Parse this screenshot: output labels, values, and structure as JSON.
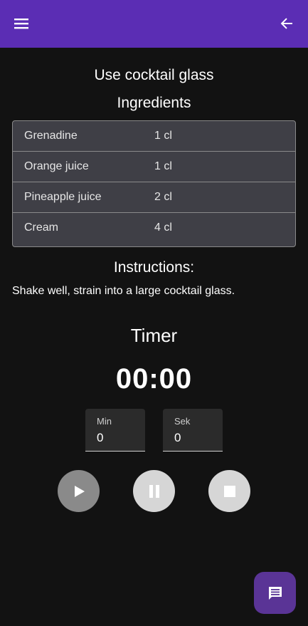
{
  "appbar": {
    "menu_icon": "menu-icon",
    "back_icon": "arrow-back-icon",
    "color": "#5b2db4"
  },
  "glass": "Use cocktail glass",
  "ingredients_title": "Ingredients",
  "ingredients": [
    {
      "name": "Grenadine",
      "amount": "1 cl"
    },
    {
      "name": "Orange juice",
      "amount": "1 cl"
    },
    {
      "name": "Pineapple juice",
      "amount": "2 cl"
    },
    {
      "name": "Cream",
      "amount": "4 cl"
    }
  ],
  "instructions_title": "Instructions:",
  "instructions_text": "Shake well, strain into a large cocktail glass.",
  "timer": {
    "title": "Timer",
    "display": "00:00",
    "min_label": "Min",
    "min_value": "0",
    "sek_label": "Sek",
    "sek_value": "0"
  },
  "controls": {
    "play_icon": "play-icon",
    "pause_icon": "pause-icon",
    "stop_icon": "stop-icon"
  },
  "fab": {
    "icon": "chat-icon",
    "color": "#5a3496"
  }
}
